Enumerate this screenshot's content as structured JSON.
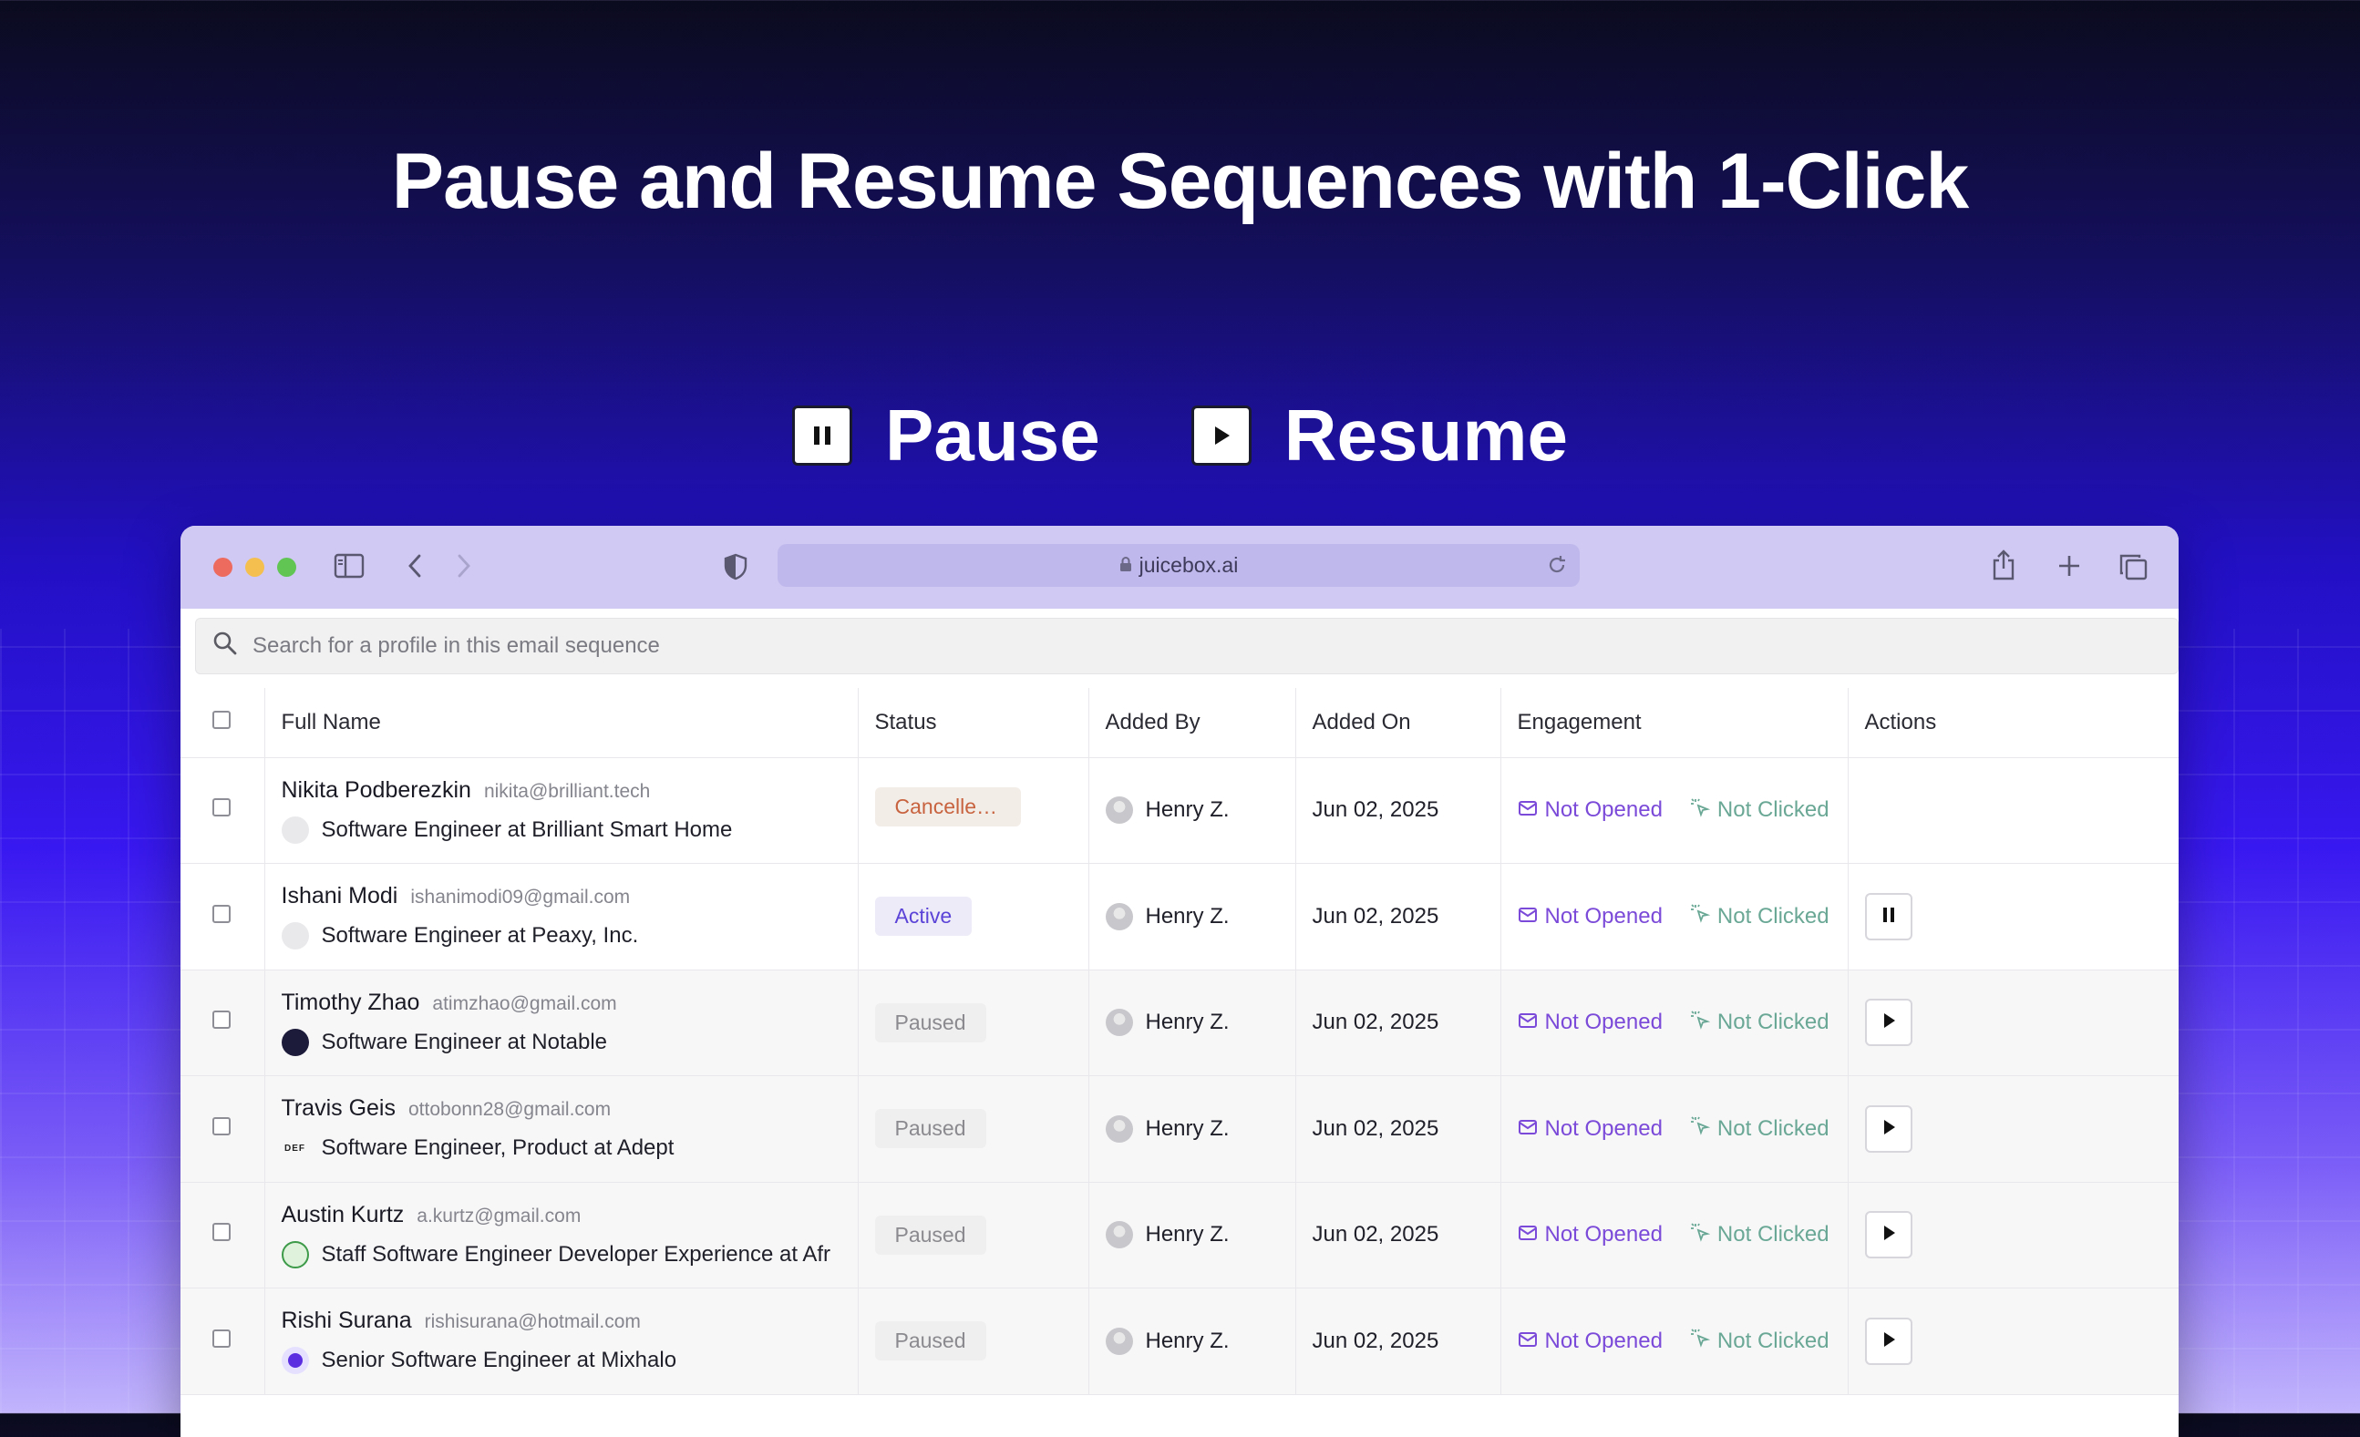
{
  "headline": "Pause and Resume Sequences with 1-Click",
  "legend": {
    "pause_label": "Pause",
    "resume_label": "Resume"
  },
  "browser": {
    "url": "juicebox.ai"
  },
  "search": {
    "placeholder": "Search for a profile in this email sequence"
  },
  "table": {
    "headers": [
      "Full Name",
      "Status",
      "Added By",
      "Added On",
      "Engagement",
      "Actions"
    ],
    "rows": [
      {
        "name": "Nikita Podberezkin",
        "email": "nikita@brilliant.tech",
        "role": "Software Engineer at Brilliant Smart Home",
        "status": "Cancelled (E...",
        "status_type": "cancelled",
        "added_by": "Henry Z.",
        "added_on": "Jun 02, 2025",
        "opened": "Not Opened",
        "clicked": "Not Clicked",
        "action": "none",
        "logo": "placeholder"
      },
      {
        "name": "Ishani Modi",
        "email": "ishanimodi09@gmail.com",
        "role": "Software Engineer at Peaxy, Inc.",
        "status": "Active",
        "status_type": "active",
        "added_by": "Henry Z.",
        "added_on": "Jun 02, 2025",
        "opened": "Not Opened",
        "clicked": "Not Clicked",
        "action": "pause",
        "logo": "placeholder"
      },
      {
        "name": "Timothy Zhao",
        "email": "atimzhao@gmail.com",
        "role": "Software Engineer at Notable",
        "status": "Paused",
        "status_type": "paused",
        "added_by": "Henry Z.",
        "added_on": "Jun 02, 2025",
        "opened": "Not Opened",
        "clicked": "Not Clicked",
        "action": "resume",
        "logo": "notable"
      },
      {
        "name": "Travis Geis",
        "email": "ottobonn28@gmail.com",
        "role": "Software Engineer, Product at Adept",
        "status": "Paused",
        "status_type": "paused",
        "added_by": "Henry Z.",
        "added_on": "Jun 02, 2025",
        "opened": "Not Opened",
        "clicked": "Not Clicked",
        "action": "resume",
        "logo": "adept"
      },
      {
        "name": "Austin Kurtz",
        "email": "a.kurtz@gmail.com",
        "role": "Staff Software Engineer Developer Experience at Afr",
        "status": "Paused",
        "status_type": "paused",
        "added_by": "Henry Z.",
        "added_on": "Jun 02, 2025",
        "opened": "Not Opened",
        "clicked": "Not Clicked",
        "action": "resume",
        "logo": "green"
      },
      {
        "name": "Rishi Surana",
        "email": "rishisurana@hotmail.com",
        "role": "Senior Software Engineer at Mixhalo",
        "status": "Paused",
        "status_type": "paused",
        "added_by": "Henry Z.",
        "added_on": "Jun 02, 2025",
        "opened": "Not Opened",
        "clicked": "Not Clicked",
        "action": "resume",
        "logo": "purple"
      }
    ]
  },
  "colors": {
    "accent": "#5b43d8",
    "opened": "#7b4ad8",
    "clicked": "#6aa895",
    "cancelled": "#c8633f",
    "titlebar": "#cfc9f3"
  },
  "icons": {
    "pause": "pause-icon",
    "resume": "play-icon",
    "search": "search-icon",
    "lock": "lock-icon",
    "reload": "reload-icon",
    "share": "share-icon",
    "new_tab": "plus-icon",
    "tabs": "tabs-overview-icon",
    "sidebar": "sidebar-icon",
    "back": "chevron-left-icon",
    "forward": "chevron-right-icon",
    "shield": "shield-icon",
    "mail": "mail-icon",
    "click": "cursor-click-icon"
  }
}
